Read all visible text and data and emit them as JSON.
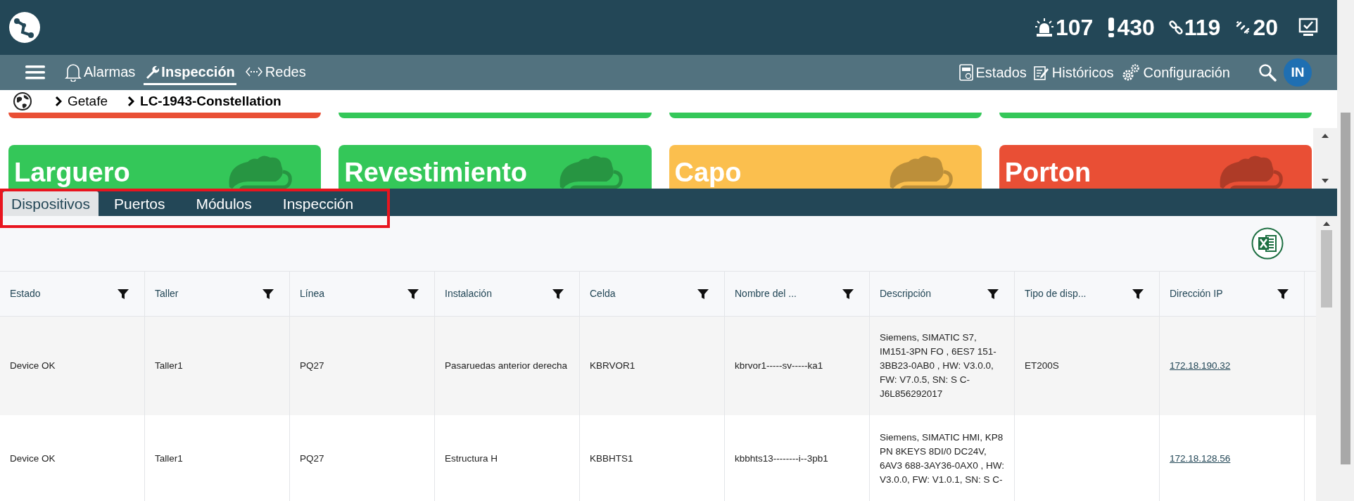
{
  "header": {
    "counters": [
      {
        "kind": "alarm",
        "value": "107"
      },
      {
        "kind": "warning",
        "value": "430"
      },
      {
        "kind": "link",
        "value": "119"
      },
      {
        "kind": "broken-link",
        "value": "20"
      }
    ]
  },
  "nav": {
    "items": [
      {
        "kind": "bell",
        "label": "Alarmas",
        "selected": false
      },
      {
        "kind": "wrench",
        "label": "Inspección",
        "selected": true
      },
      {
        "kind": "arrows",
        "label": "Redes",
        "selected": false
      }
    ],
    "right_items": [
      {
        "kind": "form",
        "label": "Estados"
      },
      {
        "kind": "edit",
        "label": "Históricos"
      },
      {
        "kind": "gears",
        "label": "Configuración"
      }
    ],
    "avatar": "IN"
  },
  "breadcrumb": [
    "Getafe",
    "LC-1943-Constellation"
  ],
  "cards_above": [
    {
      "color": "#e94f35"
    },
    {
      "color": "#34c759"
    },
    {
      "color": "#34c759"
    },
    {
      "color": "#34c759"
    }
  ],
  "cards": [
    {
      "title": "Larguero",
      "color": "#34c759"
    },
    {
      "title": "Revestimiento",
      "color": "#34c759"
    },
    {
      "title": "Capo",
      "color": "#fbbf4e"
    },
    {
      "title": "Porton",
      "color": "#e94f35"
    }
  ],
  "tabs": [
    {
      "label": "Dispositivos",
      "selected": true
    },
    {
      "label": "Puertos",
      "selected": false
    },
    {
      "label": "Módulos",
      "selected": false
    },
    {
      "label": "Inspección",
      "selected": false
    }
  ],
  "table": {
    "columns": [
      {
        "label": "Estado",
        "kind": "text"
      },
      {
        "label": "Taller",
        "kind": "text"
      },
      {
        "label": "Línea",
        "kind": "text"
      },
      {
        "label": "Instalación",
        "kind": "text"
      },
      {
        "label": "Celda",
        "kind": "text"
      },
      {
        "label": "Nombre del ...",
        "kind": "text"
      },
      {
        "label": "Descripción",
        "kind": "text"
      },
      {
        "label": "Tipo de disp...",
        "kind": "text"
      },
      {
        "label": "Dirección IP",
        "kind": "link"
      }
    ],
    "rows": [
      {
        "cells": [
          "Device OK",
          "Taller1",
          "PQ27",
          "Pasaruedas anterior derecha",
          "KBRVOR1",
          "kbrvor1-----sv-----ka1",
          "Siemens, SIMATIC S7, IM151-3PN FO , 6ES7 151-3BB23-0AB0 , HW: V3.0.0, FW: V7.0.5, SN: S C-J6L856292017",
          "ET200S",
          "172.18.190.32"
        ]
      },
      {
        "cells": [
          "Device OK",
          "Taller1",
          "PQ27",
          "Estructura H",
          "KBBHTS1",
          "kbbhts13--------i--3pb1",
          "Siemens, SIMATIC HMI, KP8 PN 8KEYS 8DI/0 DC24V, 6AV3 688-3AY36-0AX0 , HW: V3.0.0, FW: V1.0.1, SN: S C-",
          "",
          "172.18.128.56"
        ]
      }
    ]
  }
}
